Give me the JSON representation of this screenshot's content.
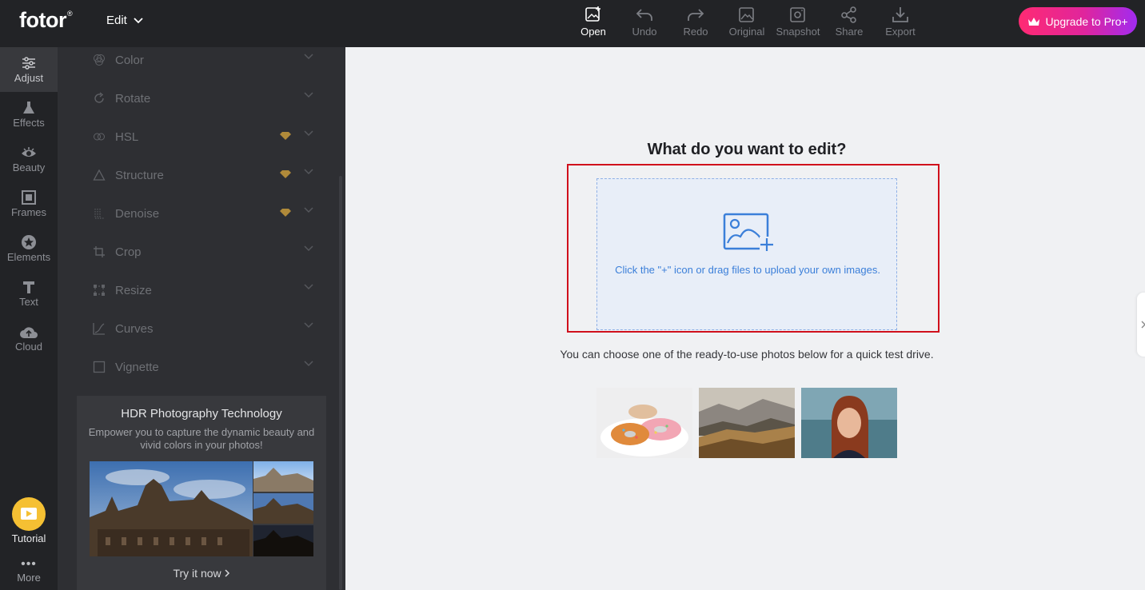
{
  "app": {
    "logo": "fotor",
    "logo_mark": "®",
    "edit_menu_label": "Edit"
  },
  "toolbar": {
    "open": "Open",
    "undo": "Undo",
    "redo": "Redo",
    "original": "Original",
    "snapshot": "Snapshot",
    "share": "Share",
    "export": "Export",
    "upgrade": "Upgrade to Pro+"
  },
  "rail": {
    "adjust": "Adjust",
    "effects": "Effects",
    "beauty": "Beauty",
    "frames": "Frames",
    "elements": "Elements",
    "text": "Text",
    "cloud": "Cloud",
    "tutorial": "Tutorial",
    "more": "More"
  },
  "panel": {
    "rows": [
      "Color",
      "Rotate",
      "HSL",
      "Structure",
      "Denoise",
      "Crop",
      "Resize",
      "Curves",
      "Vignette"
    ],
    "hdr": {
      "title": "HDR Photography Technology",
      "desc": "Empower you to capture the dynamic beauty and vivid colors in your photos!",
      "try": "Try it now"
    }
  },
  "main": {
    "title": "What do you want to edit?",
    "upload_text": "Click the \"+\" icon or drag files to upload your own images.",
    "hint": "You can choose one of the ready-to-use photos below for a quick test drive."
  },
  "colors": {
    "accent_blue": "#3b7fd9",
    "highlight_red": "#d0101c",
    "upgrade_gradient_start": "#ff2a73",
    "upgrade_gradient_end": "#a12bf0",
    "premium_gem": "#b08a3a"
  }
}
